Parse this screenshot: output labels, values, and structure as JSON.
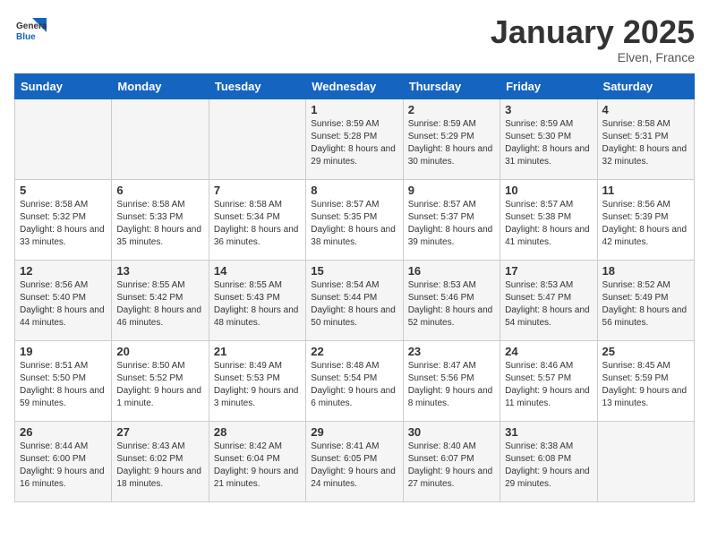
{
  "header": {
    "logo_general": "General",
    "logo_blue": "Blue",
    "month_title": "January 2025",
    "location": "Elven, France"
  },
  "weekdays": [
    "Sunday",
    "Monday",
    "Tuesday",
    "Wednesday",
    "Thursday",
    "Friday",
    "Saturday"
  ],
  "weeks": [
    [
      {
        "day": "",
        "info": ""
      },
      {
        "day": "",
        "info": ""
      },
      {
        "day": "",
        "info": ""
      },
      {
        "day": "1",
        "info": "Sunrise: 8:59 AM\nSunset: 5:28 PM\nDaylight: 8 hours and 29 minutes."
      },
      {
        "day": "2",
        "info": "Sunrise: 8:59 AM\nSunset: 5:29 PM\nDaylight: 8 hours and 30 minutes."
      },
      {
        "day": "3",
        "info": "Sunrise: 8:59 AM\nSunset: 5:30 PM\nDaylight: 8 hours and 31 minutes."
      },
      {
        "day": "4",
        "info": "Sunrise: 8:58 AM\nSunset: 5:31 PM\nDaylight: 8 hours and 32 minutes."
      }
    ],
    [
      {
        "day": "5",
        "info": "Sunrise: 8:58 AM\nSunset: 5:32 PM\nDaylight: 8 hours and 33 minutes."
      },
      {
        "day": "6",
        "info": "Sunrise: 8:58 AM\nSunset: 5:33 PM\nDaylight: 8 hours and 35 minutes."
      },
      {
        "day": "7",
        "info": "Sunrise: 8:58 AM\nSunset: 5:34 PM\nDaylight: 8 hours and 36 minutes."
      },
      {
        "day": "8",
        "info": "Sunrise: 8:57 AM\nSunset: 5:35 PM\nDaylight: 8 hours and 38 minutes."
      },
      {
        "day": "9",
        "info": "Sunrise: 8:57 AM\nSunset: 5:37 PM\nDaylight: 8 hours and 39 minutes."
      },
      {
        "day": "10",
        "info": "Sunrise: 8:57 AM\nSunset: 5:38 PM\nDaylight: 8 hours and 41 minutes."
      },
      {
        "day": "11",
        "info": "Sunrise: 8:56 AM\nSunset: 5:39 PM\nDaylight: 8 hours and 42 minutes."
      }
    ],
    [
      {
        "day": "12",
        "info": "Sunrise: 8:56 AM\nSunset: 5:40 PM\nDaylight: 8 hours and 44 minutes."
      },
      {
        "day": "13",
        "info": "Sunrise: 8:55 AM\nSunset: 5:42 PM\nDaylight: 8 hours and 46 minutes."
      },
      {
        "day": "14",
        "info": "Sunrise: 8:55 AM\nSunset: 5:43 PM\nDaylight: 8 hours and 48 minutes."
      },
      {
        "day": "15",
        "info": "Sunrise: 8:54 AM\nSunset: 5:44 PM\nDaylight: 8 hours and 50 minutes."
      },
      {
        "day": "16",
        "info": "Sunrise: 8:53 AM\nSunset: 5:46 PM\nDaylight: 8 hours and 52 minutes."
      },
      {
        "day": "17",
        "info": "Sunrise: 8:53 AM\nSunset: 5:47 PM\nDaylight: 8 hours and 54 minutes."
      },
      {
        "day": "18",
        "info": "Sunrise: 8:52 AM\nSunset: 5:49 PM\nDaylight: 8 hours and 56 minutes."
      }
    ],
    [
      {
        "day": "19",
        "info": "Sunrise: 8:51 AM\nSunset: 5:50 PM\nDaylight: 8 hours and 59 minutes."
      },
      {
        "day": "20",
        "info": "Sunrise: 8:50 AM\nSunset: 5:52 PM\nDaylight: 9 hours and 1 minute."
      },
      {
        "day": "21",
        "info": "Sunrise: 8:49 AM\nSunset: 5:53 PM\nDaylight: 9 hours and 3 minutes."
      },
      {
        "day": "22",
        "info": "Sunrise: 8:48 AM\nSunset: 5:54 PM\nDaylight: 9 hours and 6 minutes."
      },
      {
        "day": "23",
        "info": "Sunrise: 8:47 AM\nSunset: 5:56 PM\nDaylight: 9 hours and 8 minutes."
      },
      {
        "day": "24",
        "info": "Sunrise: 8:46 AM\nSunset: 5:57 PM\nDaylight: 9 hours and 11 minutes."
      },
      {
        "day": "25",
        "info": "Sunrise: 8:45 AM\nSunset: 5:59 PM\nDaylight: 9 hours and 13 minutes."
      }
    ],
    [
      {
        "day": "26",
        "info": "Sunrise: 8:44 AM\nSunset: 6:00 PM\nDaylight: 9 hours and 16 minutes."
      },
      {
        "day": "27",
        "info": "Sunrise: 8:43 AM\nSunset: 6:02 PM\nDaylight: 9 hours and 18 minutes."
      },
      {
        "day": "28",
        "info": "Sunrise: 8:42 AM\nSunset: 6:04 PM\nDaylight: 9 hours and 21 minutes."
      },
      {
        "day": "29",
        "info": "Sunrise: 8:41 AM\nSunset: 6:05 PM\nDaylight: 9 hours and 24 minutes."
      },
      {
        "day": "30",
        "info": "Sunrise: 8:40 AM\nSunset: 6:07 PM\nDaylight: 9 hours and 27 minutes."
      },
      {
        "day": "31",
        "info": "Sunrise: 8:38 AM\nSunset: 6:08 PM\nDaylight: 9 hours and 29 minutes."
      },
      {
        "day": "",
        "info": ""
      }
    ]
  ]
}
